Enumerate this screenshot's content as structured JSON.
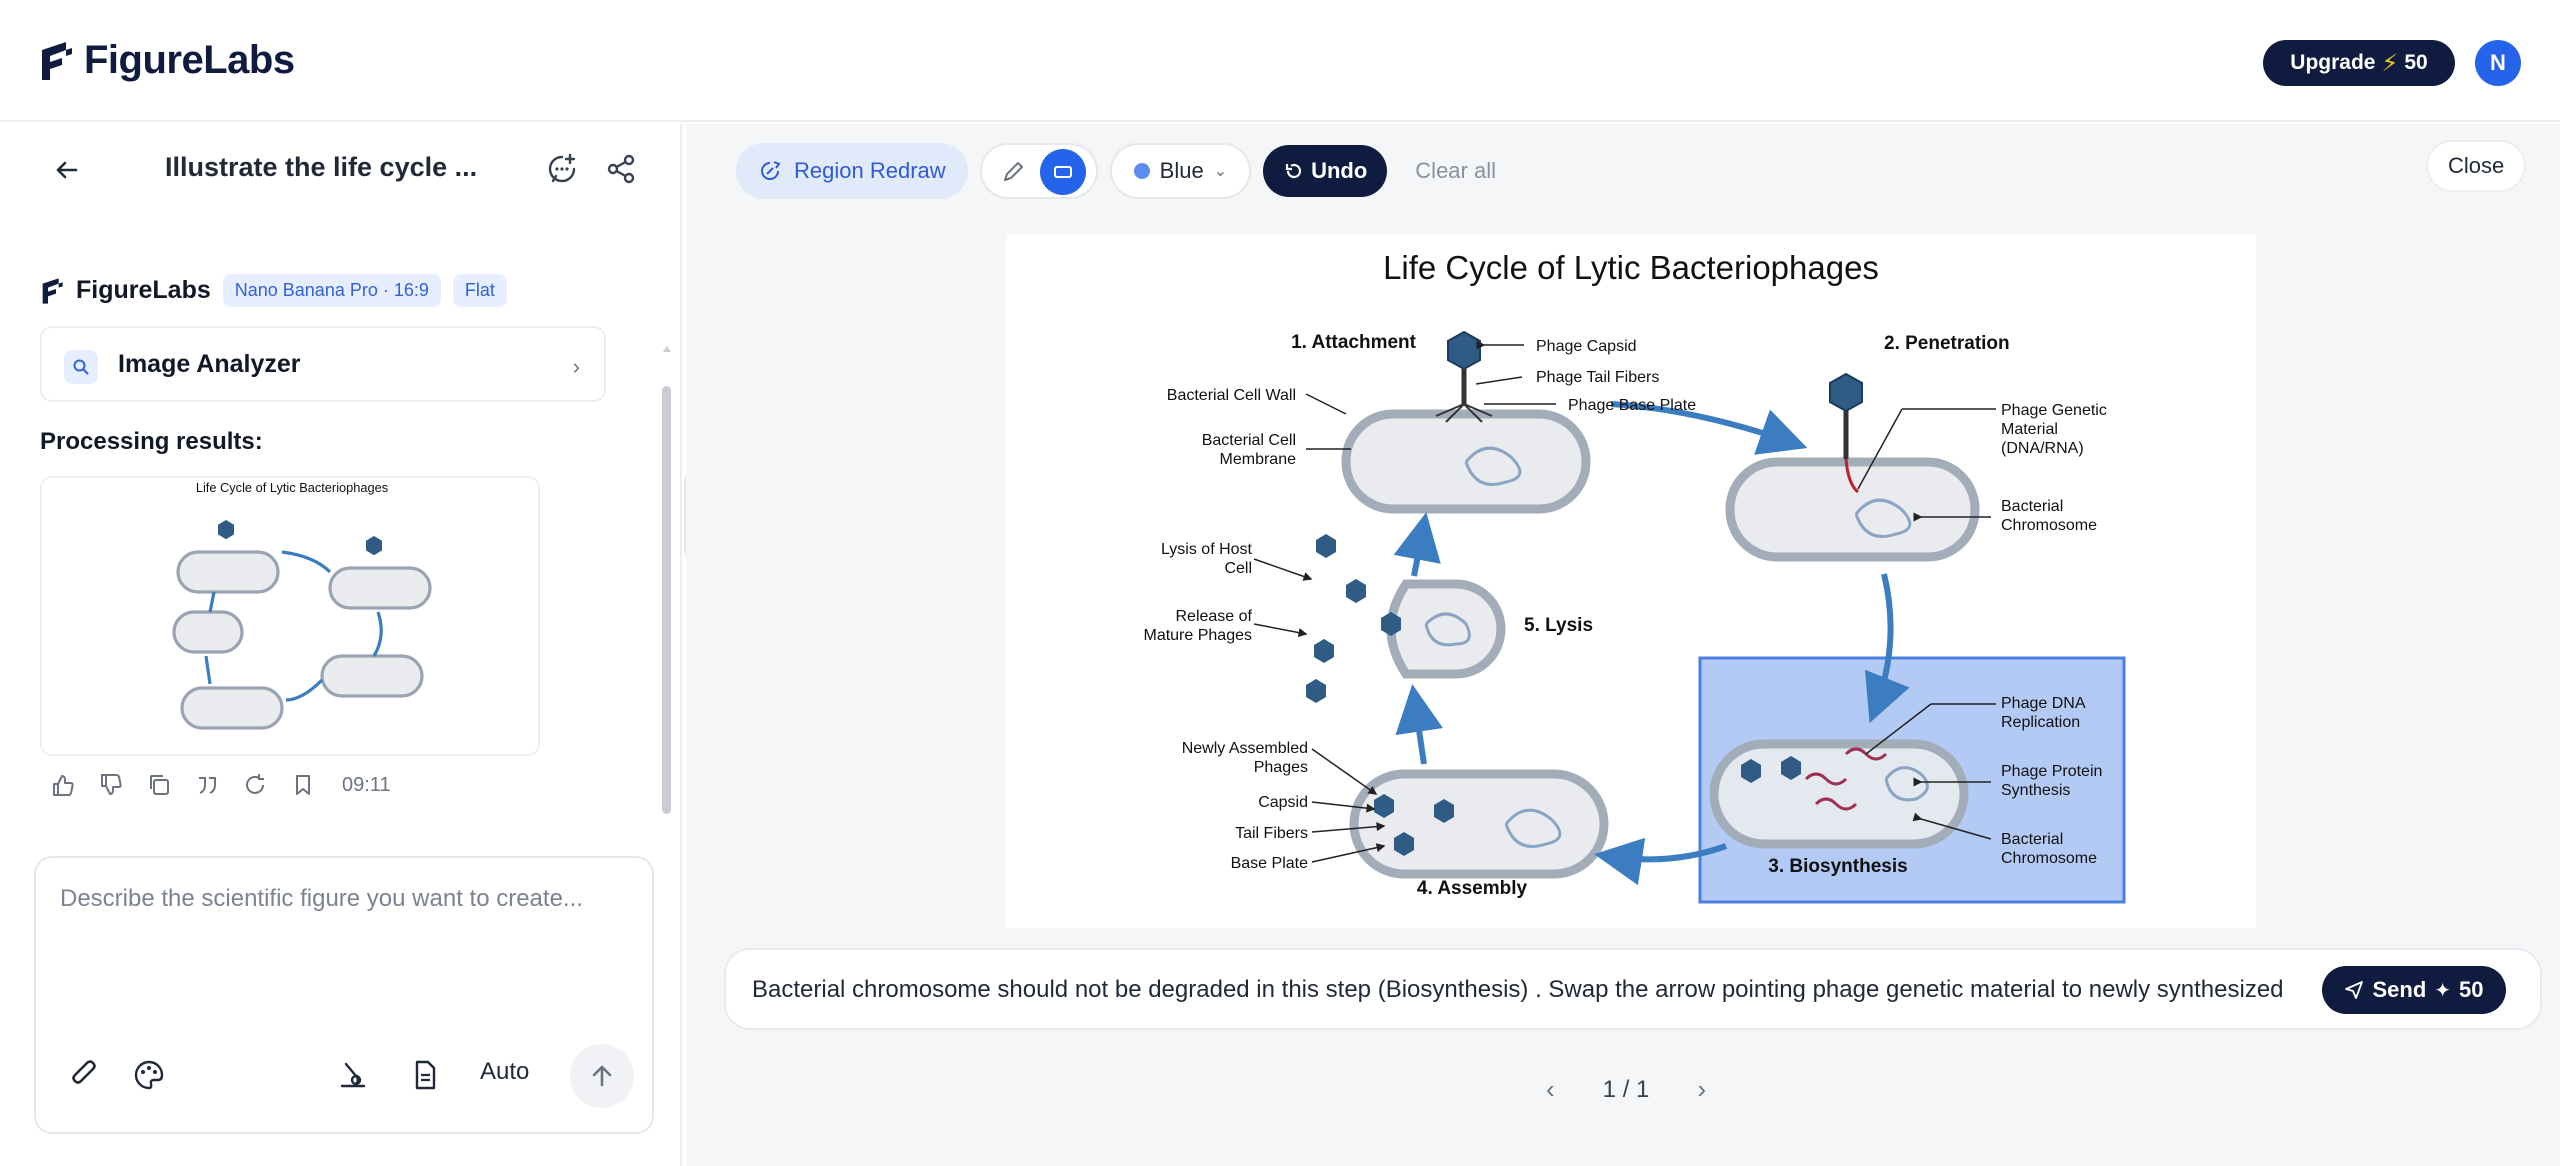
{
  "app": {
    "name": "FigureLabs"
  },
  "header": {
    "upgrade_label": "Upgrade",
    "upgrade_credits": "50",
    "avatar_initial": "N"
  },
  "left_panel": {
    "conversation_title": "Illustrate the life cycle ...",
    "brand_name": "FigureLabs",
    "model_pill": "Nano Banana Pro · 16:9",
    "style_pill": "Flat",
    "analyzer_label": "Image Analyzer",
    "processing_label": "Processing results:",
    "timestamp": "09:11",
    "composer_placeholder": "Describe the scientific figure you want to create...",
    "mode_label": "Auto"
  },
  "toolbar": {
    "region_redraw": "Region Redraw",
    "color_label": "Blue",
    "undo_label": "Undo",
    "clear_label": "Clear all",
    "close_label": "Close"
  },
  "figure": {
    "title": "Life Cycle of Lytic Bacteriophages",
    "steps": {
      "s1": "1. Attachment",
      "s2": "2. Penetration",
      "s3": "3. Biosynthesis",
      "s4": "4. Assembly",
      "s5": "5. Lysis"
    },
    "labels": {
      "phage_capsid": "Phage Capsid",
      "phage_tail_fibers": "Phage Tail Fibers",
      "phage_base_plate": "Phage Base Plate",
      "bacterial_cell_wall": "Bacterial Cell Wall",
      "bacterial_cell_membrane_1": "Bacterial Cell",
      "bacterial_cell_membrane_2": "Membrane",
      "genetic_1": "Phage Genetic",
      "genetic_2": "Material",
      "genetic_3": "(DNA/RNA)",
      "bact_chrom_1": "Bacterial",
      "bact_chrom_2": "Chromosome",
      "lysis_host_1": "Lysis of Host",
      "lysis_host_2": "Cell",
      "release_1": "Release of",
      "release_2": "Mature Phages",
      "dna_rep_1": "Phage DNA",
      "dna_rep_2": "Replication",
      "protein_1": "Phage Protein",
      "protein_2": "Synthesis",
      "newly_1": "Newly Assembled",
      "newly_2": "Phages",
      "capsid": "Capsid",
      "tail_fibers": "Tail Fibers",
      "base_plate": "Base Plate"
    }
  },
  "prompt": {
    "text": "Bacterial chromosome should not be degraded in this step (Biosynthesis) . Swap the arrow pointing phage genetic material to newly synthesized",
    "send_label": "Send",
    "send_credits": "50"
  },
  "pager": {
    "label": "1 / 1"
  },
  "colors": {
    "navy": "#0f1c3f",
    "accent": "#2563eb",
    "selection": "#7aa3f0"
  }
}
